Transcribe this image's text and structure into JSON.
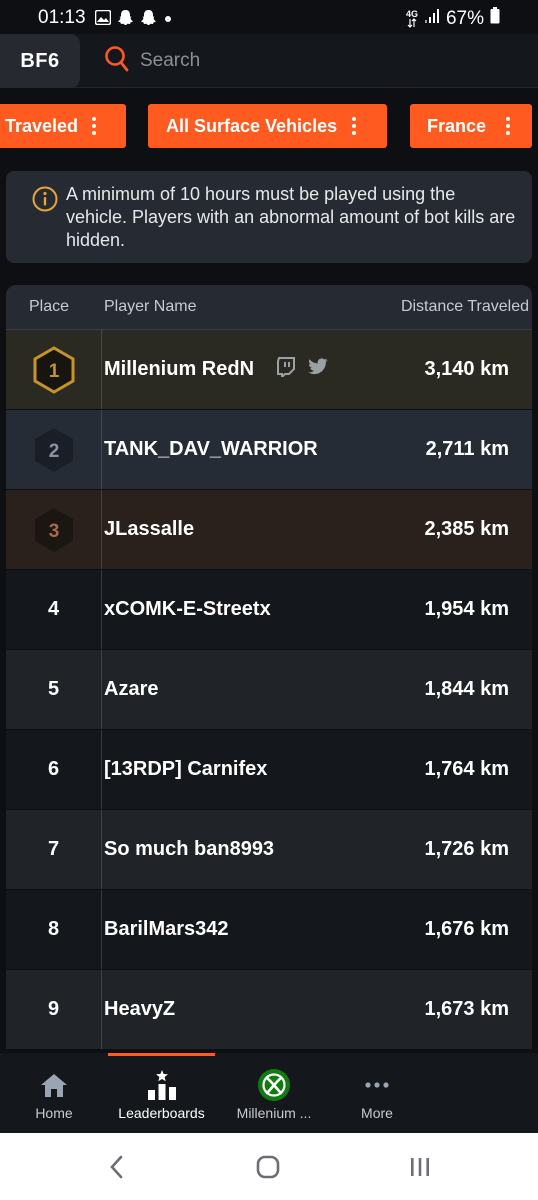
{
  "status_bar": {
    "time": "01:13",
    "network": "4G",
    "battery": "67%"
  },
  "top_bar": {
    "game_tab": "BF6",
    "search_placeholder": "Search"
  },
  "filters": [
    {
      "label": "Traveled"
    },
    {
      "label": "All Surface Vehicles"
    },
    {
      "label": "France"
    }
  ],
  "notice": {
    "text": "A minimum of 10 hours must be played using the vehicle. Players with an abnormal amount of bot kills are hidden."
  },
  "table": {
    "headers": {
      "place": "Place",
      "name": "Player Name",
      "distance": "Distance Traveled"
    },
    "rows": [
      {
        "place": "1",
        "name": "Millenium RedN",
        "distance": "3,140 km"
      },
      {
        "place": "2",
        "name": "TANK_DAV_WARRIOR",
        "distance": "2,711 km"
      },
      {
        "place": "3",
        "name": "JLassalle",
        "distance": "2,385 km"
      },
      {
        "place": "4",
        "name": "xCOMK-E-Streetx",
        "distance": "1,954 km"
      },
      {
        "place": "5",
        "name": "Azare",
        "distance": "1,844 km"
      },
      {
        "place": "6",
        "name": "[13RDP] Carnifex",
        "distance": "1,764 km"
      },
      {
        "place": "7",
        "name": "So much ban8993",
        "distance": "1,726 km"
      },
      {
        "place": "8",
        "name": "BarilMars342",
        "distance": "1,676 km"
      },
      {
        "place": "9",
        "name": "HeavyZ",
        "distance": "1,673 km"
      }
    ]
  },
  "bottom_nav": [
    {
      "label": "Home",
      "icon": "home-icon"
    },
    {
      "label": "Leaderboards",
      "icon": "leaderboard-icon",
      "active": true
    },
    {
      "label": "Millenium ...",
      "icon": "xbox-icon"
    },
    {
      "label": "More",
      "icon": "more-icon"
    }
  ],
  "colors": {
    "accent": "#ff5a1f",
    "gold": "#c8922a",
    "silver": "#8a92a6",
    "bronze": "#a86a4a"
  }
}
